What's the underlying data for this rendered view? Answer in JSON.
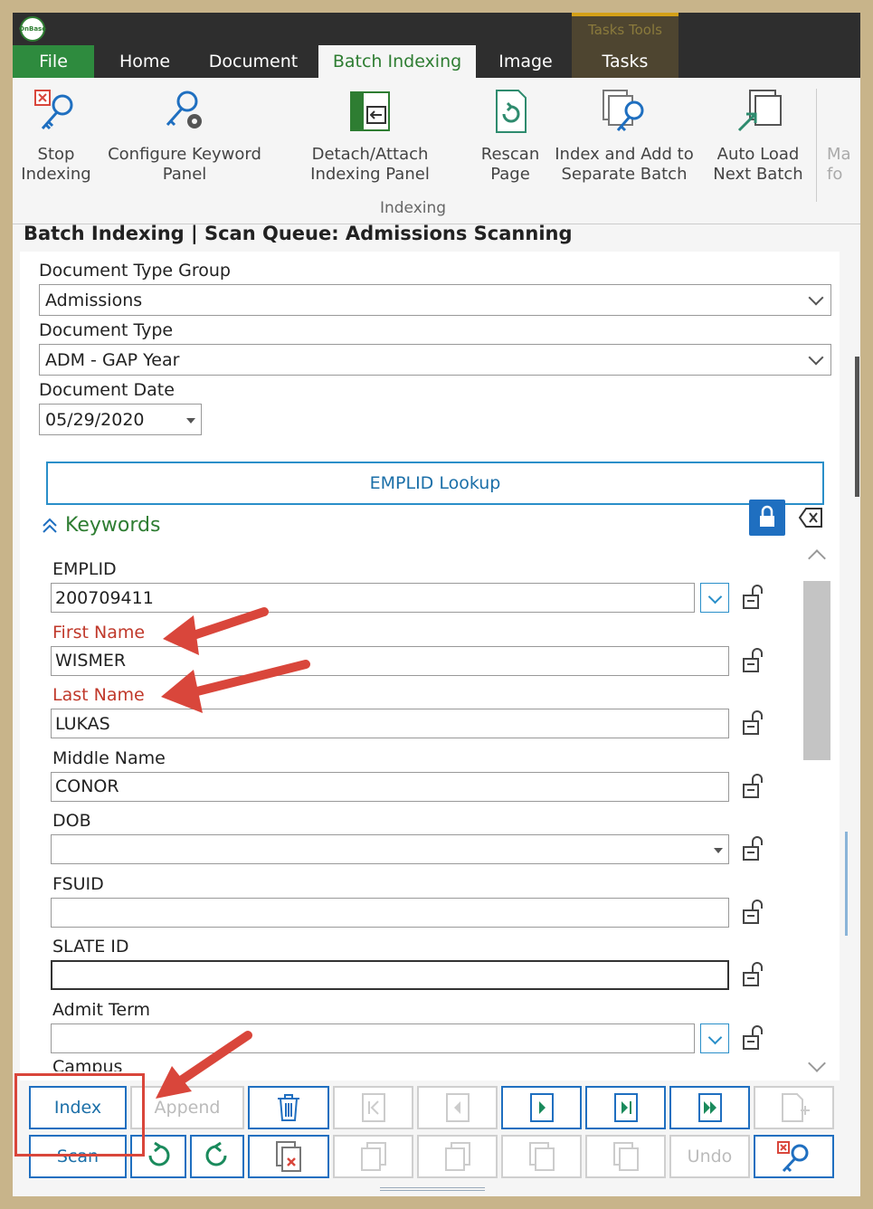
{
  "app": {
    "logo_text": "OnBase",
    "tabs": [
      {
        "label": "File"
      },
      {
        "label": "Home"
      },
      {
        "label": "Document"
      },
      {
        "label": "Batch Indexing"
      },
      {
        "label": "Image"
      },
      {
        "label": "Tasks"
      }
    ],
    "contextual_group_label": "Tasks Tools"
  },
  "ribbon": {
    "buttons": [
      {
        "label": "Stop Indexing",
        "icon": "stop-indexing-key-icon"
      },
      {
        "label": "Configure Keyword Panel",
        "icon": "configure-key-gear-icon"
      },
      {
        "label": "Detach/Attach Indexing Panel",
        "icon": "detach-panel-icon"
      },
      {
        "label": "Rescan Page",
        "icon": "rescan-page-icon"
      },
      {
        "label": "Index and Add to Separate Batch",
        "icon": "index-add-batch-icon"
      },
      {
        "label": "Auto Load Next Batch",
        "icon": "auto-load-icon"
      },
      {
        "label": "Mar fo",
        "icon": "cut-off-icon"
      }
    ],
    "group_label": "Indexing"
  },
  "panel": {
    "title": "Batch Indexing | Scan Queue: Admissions Scanning",
    "doc_type_group_label": "Document Type Group",
    "doc_type_group_value": "Admissions",
    "doc_type_label": "Document Type",
    "doc_type_value": "ADM - GAP Year",
    "doc_date_label": "Document Date",
    "doc_date_value": "05/29/2020",
    "lookup_label": "EMPLID Lookup",
    "keywords_label": "Keywords"
  },
  "keywords": [
    {
      "label": "EMPLID",
      "value": "200709411",
      "dropdown": true,
      "highlight": false
    },
    {
      "label": "First Name",
      "value": "WISMER",
      "dropdown": false,
      "highlight": true
    },
    {
      "label": "Last Name",
      "value": "LUKAS",
      "dropdown": false,
      "highlight": true
    },
    {
      "label": "Middle Name",
      "value": "CONOR",
      "dropdown": false,
      "highlight": false
    },
    {
      "label": "DOB",
      "value": "",
      "dropdown": false,
      "highlight": false
    },
    {
      "label": "FSUID",
      "value": "",
      "dropdown": false,
      "highlight": false
    },
    {
      "label": "SLATE ID",
      "value": "",
      "dropdown": false,
      "highlight": false
    },
    {
      "label": "Admit Term",
      "value": "",
      "dropdown": true,
      "highlight": false
    },
    {
      "label": "Campus",
      "value": "",
      "dropdown": false,
      "highlight": false
    }
  ],
  "toolbar": {
    "index_label": "Index",
    "append_label": "Append",
    "scan_label": "Scan",
    "undo_label": "Undo"
  },
  "colors": {
    "accent_green": "#2e7d32",
    "accent_blue": "#1f6fc0",
    "annotation_red": "#d9463b",
    "frame_gold": "#c8b48a"
  }
}
